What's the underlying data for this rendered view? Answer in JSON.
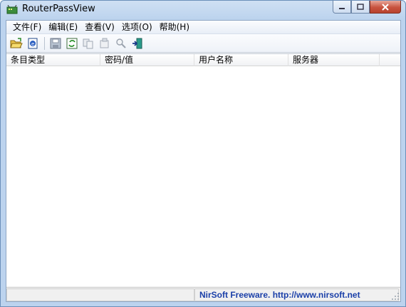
{
  "window": {
    "title": "RouterPassView"
  },
  "menu": {
    "items": [
      {
        "label": "文件(F)"
      },
      {
        "label": "编辑(E)"
      },
      {
        "label": "查看(V)"
      },
      {
        "label": "选项(O)"
      },
      {
        "label": "帮助(H)"
      }
    ]
  },
  "toolbar": {
    "buttons": [
      {
        "icon": "open-folder-icon"
      },
      {
        "icon": "open-router-file-icon"
      },
      {
        "icon": "save-icon"
      },
      {
        "icon": "refresh-icon"
      },
      {
        "icon": "copy-icon"
      },
      {
        "icon": "properties-icon"
      },
      {
        "icon": "find-icon"
      },
      {
        "icon": "exit-icon"
      }
    ]
  },
  "list": {
    "columns": [
      "条目类型",
      "密码/值",
      "用户名称",
      "服务器"
    ],
    "rows": []
  },
  "status": {
    "left": "",
    "right": "NirSoft Freeware.  http://www.nirsoft.net"
  },
  "colors": {
    "link": "#1a3fa8",
    "titlebar": "#bcd3ee",
    "close_button": "#c8533f"
  }
}
